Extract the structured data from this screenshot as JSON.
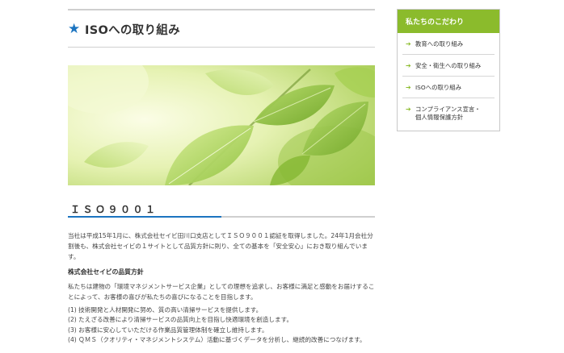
{
  "page": {
    "title": "ISOへの取り組み",
    "title_icon": "star-icon",
    "accent_color": "#1b74c0"
  },
  "section": {
    "title": "ＩＳＯ９００１",
    "paragraph": "当社は平成15年1月に、株式会社セイビ田川口支店としてＩＳＯ９００１認証を取得しました。24年1月会社分割後も、株式会社セイビの１サイトとして品質方針に則り、全ての基本を「安全安心」におき取り組んでいます。",
    "policy_title": "株式会社セイビの品質方針",
    "policy_intro": "私たちは建物の「環境マネジメントサービス企業」としての理想を追求し、お客様に満足と感動をお届けすることによって、お客様の喜びが私たちの喜びになることを目指します。",
    "policy_items": [
      "(1) 技術開発と人材開発に努め、質の高い清掃サービスを提供します。",
      "(2) たえざる改善により清掃サービスの品質向上を目指し快適環境を創造します。",
      "(3) お客様に安心していただける作業品質管理体制を確立し維持します。",
      "(4) ＱＭＳ（クオリティ・マネジメントシステム）活動に基づくデータを分析し、継続的改善につなげます。"
    ]
  },
  "sidebar": {
    "header": "私たちのこだわり",
    "header_color": "#8bbb2c",
    "items": [
      {
        "label": "教育への取り組み"
      },
      {
        "label": "安全・衛生への取り組み"
      },
      {
        "label": "ISOへの取り組み"
      },
      {
        "label": "コンプライアンス宣言・\n個人情報保護方針"
      }
    ]
  }
}
